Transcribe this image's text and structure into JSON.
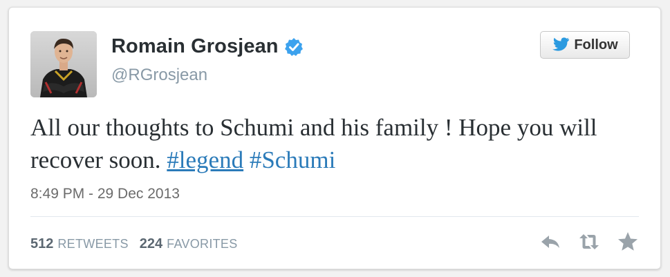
{
  "tweet": {
    "author_name": "Romain Grosjean",
    "handle": "@RGrosjean",
    "follow_label": "Follow",
    "text_before": "All our thoughts to Schumi and his family ! Hope you will recover soon. ",
    "hashtag_1": "#legend",
    "hashtag_2": "#Schumi",
    "timestamp": "8:49 PM - 29 Dec 2013",
    "retweet_count": "512",
    "retweet_label": "RETWEETS",
    "favorite_count": "224",
    "favorite_label": "FAVORITES"
  },
  "icons": {
    "verified": "verified-badge-icon",
    "follow": "twitter-bird-icon",
    "reply": "reply-icon",
    "retweet": "retweet-icon",
    "favorite": "star-icon"
  },
  "colors": {
    "link": "#2b7bb9",
    "verified": "#3ca2ee",
    "name": "#292f33",
    "muted": "#8899a6",
    "action_icon": "#9aa3aa"
  }
}
